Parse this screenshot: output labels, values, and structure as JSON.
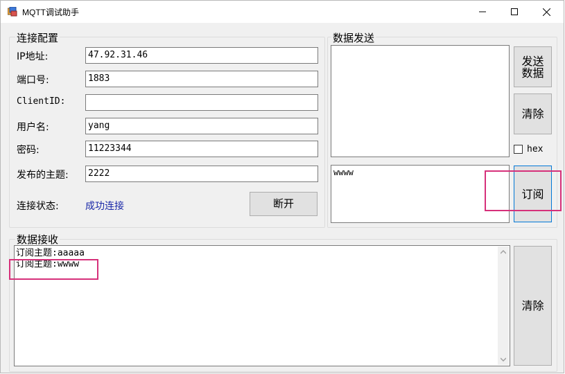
{
  "window": {
    "title": "MQTT调试助手"
  },
  "conn_group": {
    "title": "连接配置",
    "ip_label": "IP地址:",
    "ip_value": "47.92.31.46",
    "port_label": "端口号:",
    "port_value": "1883",
    "clientid_label": "ClientID:",
    "clientid_value": "",
    "user_label": "用户名:",
    "user_value": "yang",
    "pass_label": "密码:",
    "pass_value": "11223344",
    "topic_label": "发布的主题:",
    "topic_value": "2222",
    "status_label": "连接状态:",
    "status_value": "成功连接",
    "status_color": "#1a28a8",
    "disconnect_label": "断开"
  },
  "send_group": {
    "title": "数据发送",
    "send_value": "",
    "send_button": "发送\n数据",
    "clear_button": "清除",
    "hex_label": "hex",
    "hex_checked": false,
    "subscribe_value": "wwww",
    "subscribe_button": "订阅"
  },
  "recv_group": {
    "title": "数据接收",
    "lines": [
      "订阅主题:aaaaa",
      "订阅主题:wwww"
    ],
    "clear_button": "清除"
  },
  "colors": {
    "highlight": "#d6307a",
    "focus_border": "#0078d7"
  }
}
